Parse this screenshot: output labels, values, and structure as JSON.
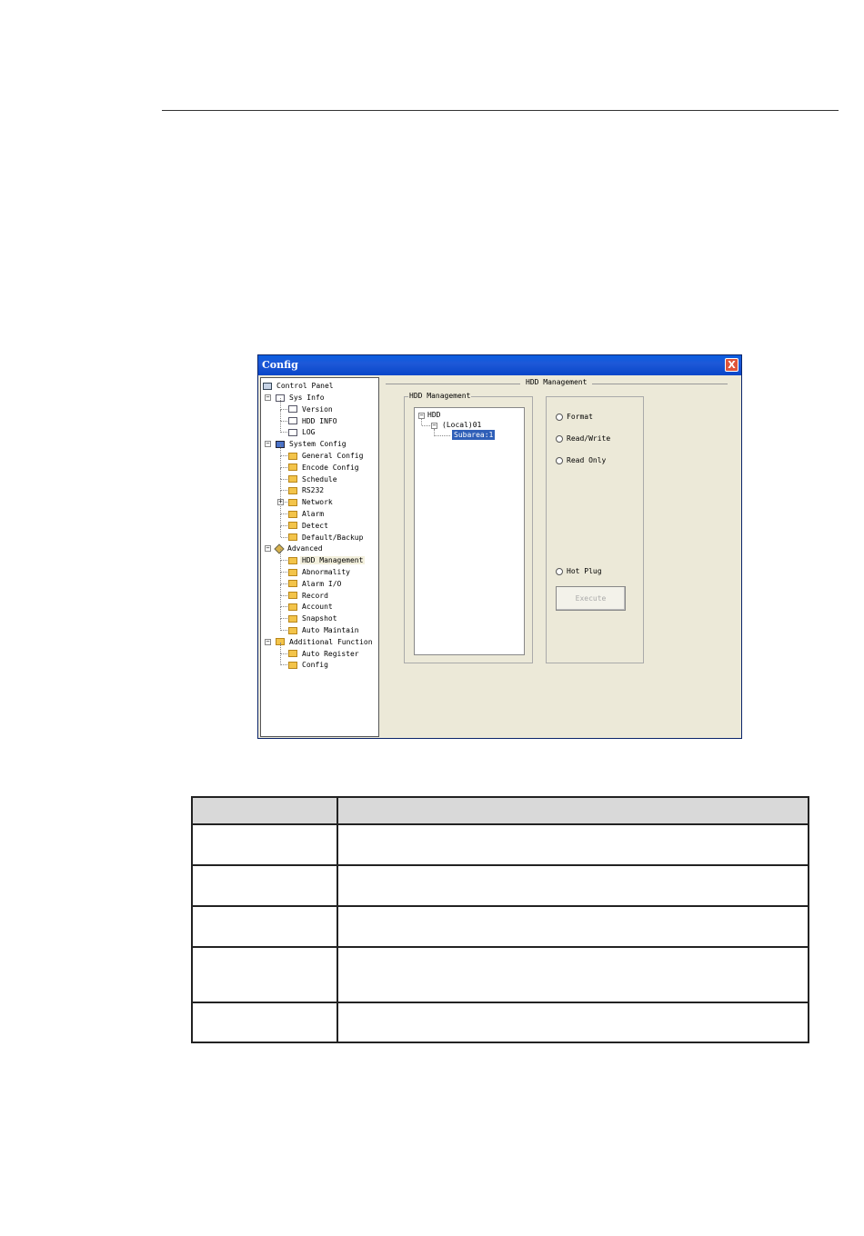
{
  "window": {
    "title": "Config",
    "close_glyph": "X"
  },
  "tree": {
    "root": "Control Panel",
    "items": [
      {
        "label": "Sys Info",
        "icon": "doc-icon",
        "level": 1,
        "expander": "−"
      },
      {
        "label": "Version",
        "icon": "doc-icon",
        "level": 2
      },
      {
        "label": "HDD INFO",
        "icon": "doc-icon",
        "level": 2
      },
      {
        "label": "LOG",
        "icon": "doc-icon",
        "level": 2
      },
      {
        "label": "System Config",
        "icon": "config-icon",
        "level": 1,
        "expander": "−"
      },
      {
        "label": "General Config",
        "icon": "folder-icon",
        "level": 2
      },
      {
        "label": "Encode Config",
        "icon": "folder-icon",
        "level": 2
      },
      {
        "label": "Schedule",
        "icon": "folder-icon",
        "level": 2
      },
      {
        "label": "RS232",
        "icon": "folder-icon",
        "level": 2
      },
      {
        "label": "Network",
        "icon": "folder-icon",
        "level": 2,
        "expander": "+"
      },
      {
        "label": "Alarm",
        "icon": "folder-icon",
        "level": 2
      },
      {
        "label": "Detect",
        "icon": "folder-icon",
        "level": 2
      },
      {
        "label": "Default/Backup",
        "icon": "folder-icon",
        "level": 2
      },
      {
        "label": "Advanced",
        "icon": "advanced-icon",
        "level": 1,
        "expander": "−"
      },
      {
        "label": "HDD Management",
        "icon": "folder-icon",
        "level": 2,
        "selected": true
      },
      {
        "label": "Abnormality",
        "icon": "folder-icon",
        "level": 2
      },
      {
        "label": "Alarm I/O",
        "icon": "folder-icon",
        "level": 2
      },
      {
        "label": "Record",
        "icon": "folder-icon",
        "level": 2
      },
      {
        "label": "Account",
        "icon": "folder-icon",
        "level": 2
      },
      {
        "label": "Snapshot",
        "icon": "folder-icon",
        "level": 2
      },
      {
        "label": "Auto Maintain",
        "icon": "folder-icon",
        "level": 2
      },
      {
        "label": "Additional Function",
        "icon": "folder-icon",
        "level": 1,
        "expander": "−"
      },
      {
        "label": "Auto Register",
        "icon": "folder-icon",
        "level": 2
      },
      {
        "label": "Config",
        "icon": "folder-icon",
        "level": 2
      }
    ]
  },
  "main": {
    "section_title": "HDD Management",
    "group_title": "HDD Management",
    "hdd_tree": {
      "root": "HDD",
      "disk": "(Local)01",
      "subarea": "Subarea:1"
    },
    "options": [
      "Format",
      "Read/Write",
      "Read Only"
    ],
    "hot_plug": "Hot Plug",
    "execute_label": "Execute"
  },
  "table": {
    "header": [
      "",
      ""
    ],
    "rows": [
      [
        "",
        ""
      ],
      [
        "",
        ""
      ],
      [
        "",
        ""
      ],
      [
        "",
        ""
      ],
      [
        "",
        ""
      ]
    ]
  }
}
